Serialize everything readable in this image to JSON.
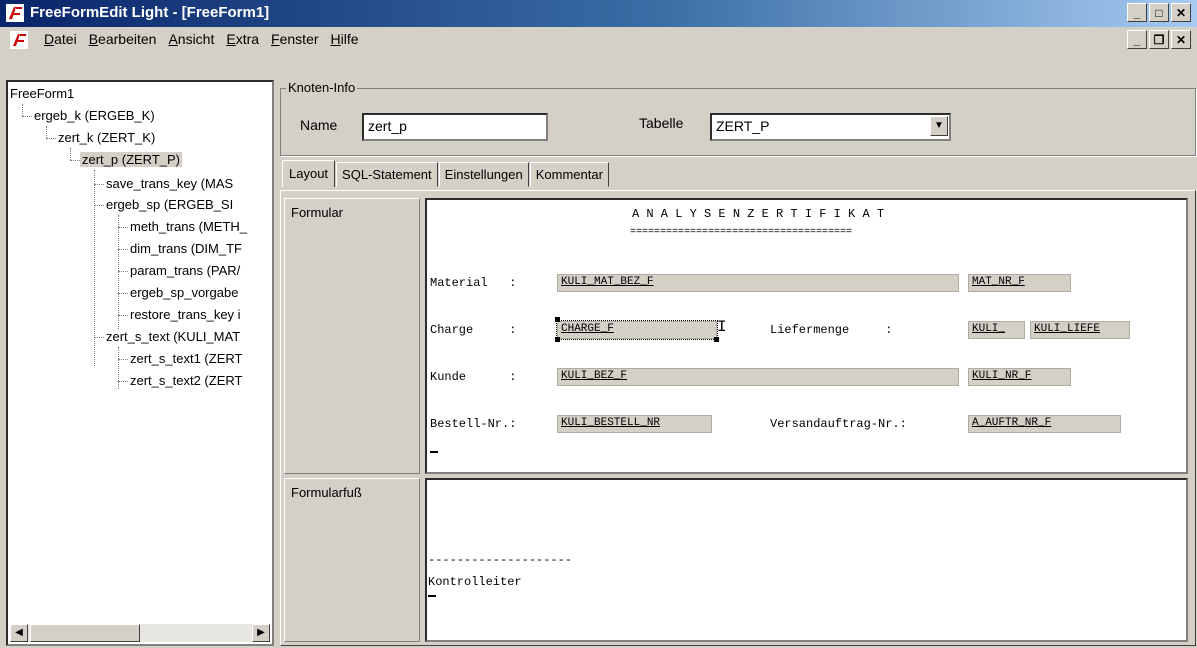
{
  "window": {
    "title": "FreeFormEdit Light - [FreeForm1]"
  },
  "menu": [
    "Datei",
    "Bearbeiten",
    "Ansicht",
    "Extra",
    "Fenster",
    "Hilfe"
  ],
  "tree": {
    "root": "FreeForm1",
    "nodes": [
      "ergeb_k (ERGEB_K)",
      "zert_k (ZERT_K)",
      "zert_p (ZERT_P)",
      "save_trans_key (MAS",
      "ergeb_sp (ERGEB_SI",
      "meth_trans (METH_",
      "dim_trans (DIM_TF",
      "param_trans (PAR/",
      "ergeb_sp_vorgabe",
      "restore_trans_key i",
      "zert_s_text (KULI_MAT",
      "zert_s_text1 (ZERT",
      "zert_s_text2 (ZERT"
    ]
  },
  "knoten_info": {
    "group_label": "Knoten-Info",
    "name_label": "Name",
    "name_value": "zert_p",
    "tabelle_label": "Tabelle",
    "tabelle_value": "ZERT_P"
  },
  "tabs": [
    "Layout",
    "SQL-Statement",
    "Einstellungen",
    "Kommentar"
  ],
  "sections": {
    "formular": "Formular",
    "formularfuss": "Formularfuß"
  },
  "form": {
    "heading": "A N A L Y S E N Z E R T I F I K A T",
    "underline": "=====================================",
    "material_label": "Material   :",
    "charge_label": "Charge     :",
    "liefermenge_label": "Liefermenge     :",
    "kunde_label": "Kunde      :",
    "bestell_label": "Bestell-Nr.:",
    "versand_label": "Versandauftrag-Nr.:",
    "fields": {
      "kuli_mat_bez": "KULI_MAT_BEZ_F",
      "mat_nr": "MAT_NR_F",
      "charge": "CHARGE_F",
      "kuli": "KULI_",
      "kuli_liefe": "KULI_LIEFE",
      "kuli_bez": "KULI_BEZ_F",
      "kuli_nr": "KULI_NR_F",
      "kuli_bestell": "KULI_BESTELL_NR",
      "a_auftr": "A_AUFTR_NR_F"
    }
  },
  "footer": {
    "dashes": "--------------------",
    "kontrolleiter": "Kontrolleiter"
  }
}
